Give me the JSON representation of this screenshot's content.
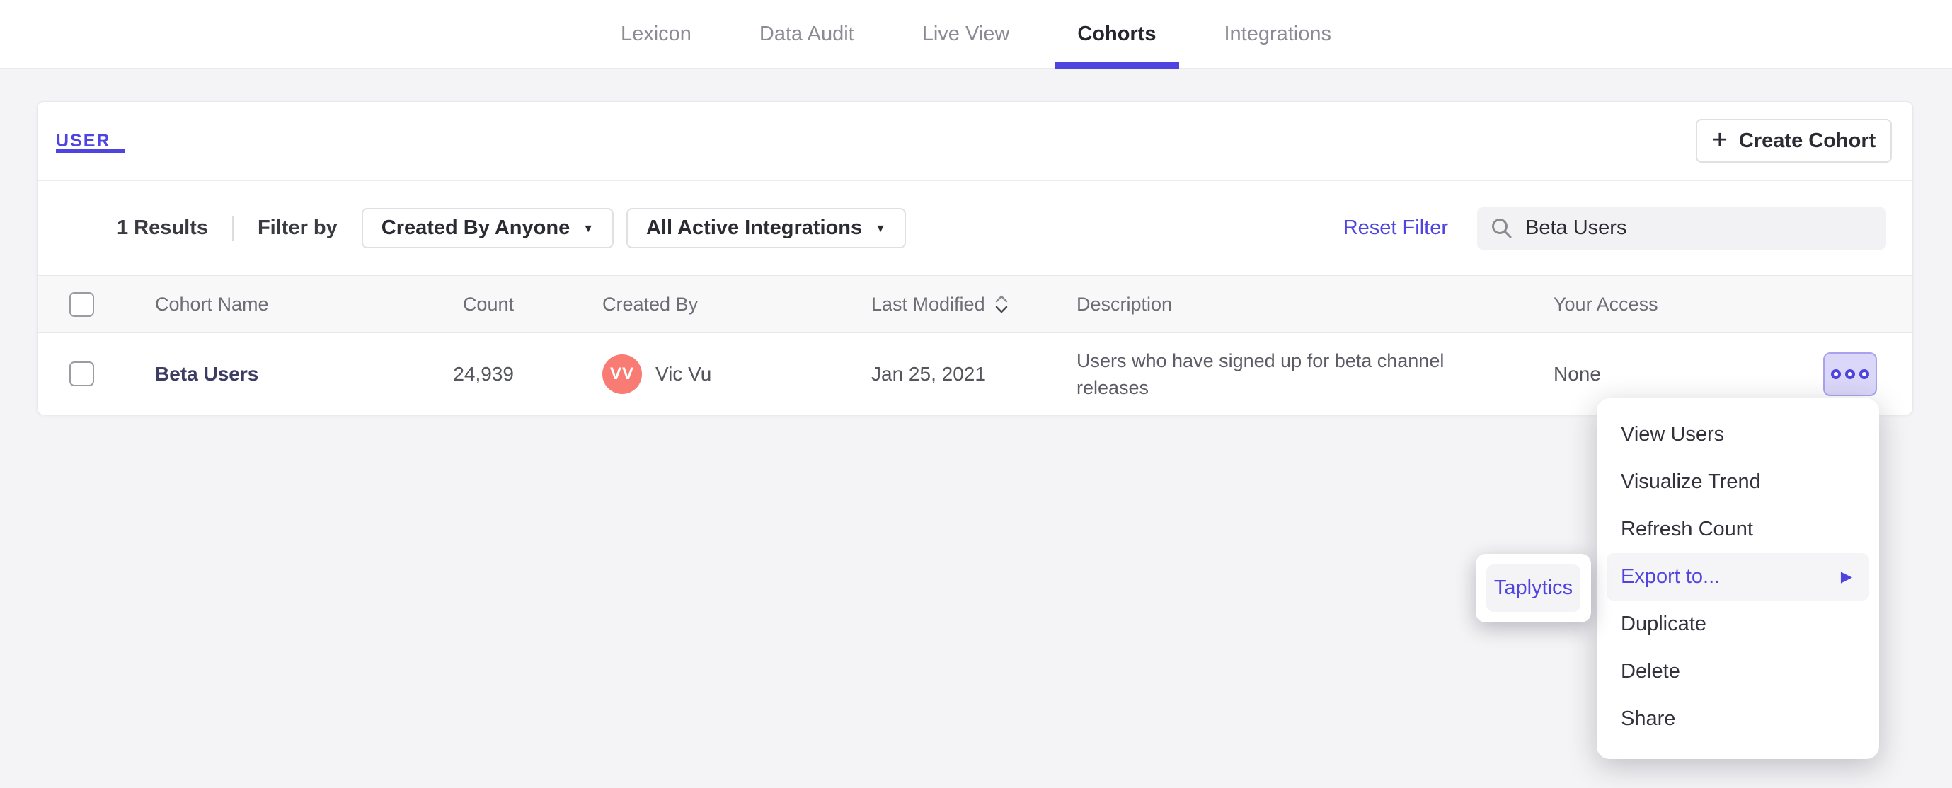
{
  "nav": {
    "items": [
      {
        "label": "Lexicon"
      },
      {
        "label": "Data Audit"
      },
      {
        "label": "Live View"
      },
      {
        "label": "Cohorts"
      },
      {
        "label": "Integrations"
      }
    ],
    "active_item": "Cohorts"
  },
  "panel": {
    "tab_label": "USER",
    "create_button_label": "Create Cohort"
  },
  "filters": {
    "results_text": "1 Results",
    "filter_by_label": "Filter by",
    "created_by_dropdown": "Created By Anyone",
    "integrations_dropdown": "All Active Integrations",
    "reset_filter_label": "Reset Filter",
    "search_value": "Beta Users"
  },
  "table": {
    "columns": {
      "name": "Cohort Name",
      "count": "Count",
      "created_by": "Created By",
      "last_modified": "Last Modified",
      "description": "Description",
      "your_access": "Your Access"
    },
    "rows": [
      {
        "name": "Beta Users",
        "count": "24,939",
        "avatar_initials": "VV",
        "created_by": "Vic Vu",
        "last_modified": "Jan 25, 2021",
        "description": "Users who have signed up for beta channel releases",
        "your_access": "None"
      }
    ]
  },
  "context_menu": {
    "items": [
      "View Users",
      "Visualize Trend",
      "Refresh Count",
      "Export to...",
      "Duplicate",
      "Delete",
      "Share"
    ],
    "active_item": "Export to...",
    "submenu_items": [
      "Taplytics"
    ]
  },
  "icons": {
    "plus": "+",
    "caret_down": "▼",
    "submenu_arrow": "▶"
  },
  "colors": {
    "accent": "#4f44e0",
    "avatar": "#f97c74",
    "active_row_button_bg": "#dad7f8"
  }
}
